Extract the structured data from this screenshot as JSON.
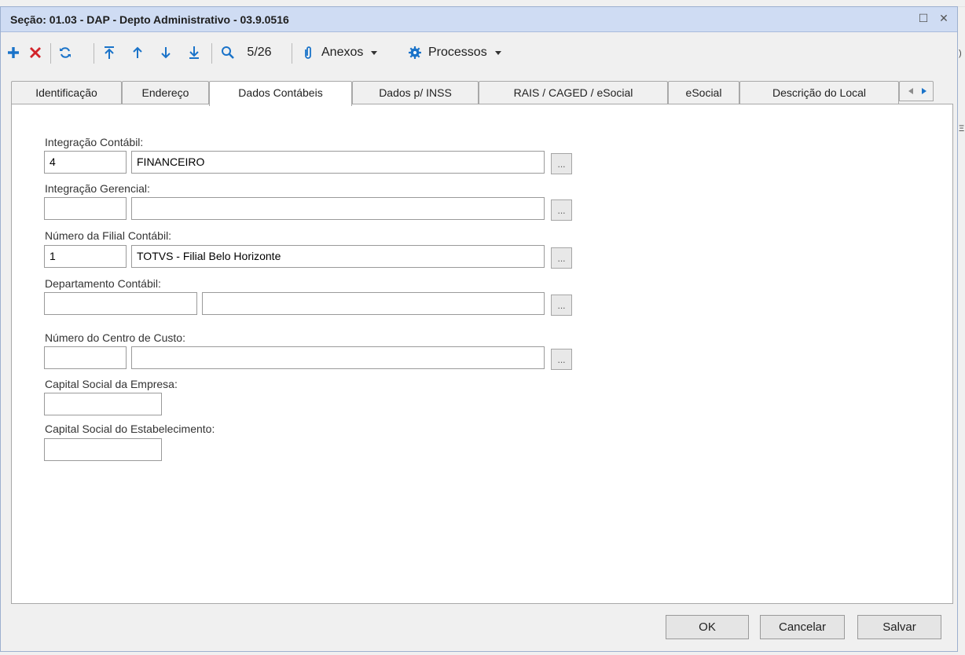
{
  "window": {
    "title": "Seção: 01.03 - DAP - Depto Administrativo - 03.9.0516",
    "maximize_glyph": "☐",
    "close_glyph": "✕"
  },
  "background_edge": {
    "fragment_1": ")",
    "fragment_2": "Ξ"
  },
  "toolbar": {
    "icons": [
      "add-icon",
      "delete-icon",
      "refresh-icon",
      "first-record-icon",
      "previous-record-icon",
      "next-record-icon",
      "last-record-icon",
      "search-icon",
      "paperclip-icon",
      "gear-icon",
      "chevron-down-icon"
    ],
    "record_counter": "5/26",
    "attachments_label": "Anexos",
    "processes_label": "Processos",
    "colors": {
      "add": "#1a73c9",
      "delete": "#d2232a",
      "nav": "#1a73c9"
    }
  },
  "tabs": [
    {
      "label": "Identificação",
      "active": false
    },
    {
      "label": "Endereço",
      "active": false
    },
    {
      "label": "Dados Contábeis",
      "active": true
    },
    {
      "label": "Dados p/ INSS",
      "active": false
    },
    {
      "label": "RAIS / CAGED / eSocial",
      "active": false
    },
    {
      "label": "eSocial",
      "active": false
    },
    {
      "label": "Descrição do Local",
      "active": false
    }
  ],
  "form": {
    "integracao_contabil": {
      "label": "Integração Contábil:",
      "code": "4",
      "description": "FINANCEIRO"
    },
    "integracao_gerencial": {
      "label": "Integração Gerencial:",
      "code": "",
      "description": ""
    },
    "filial_contabil": {
      "label": "Número da Filial Contábil:",
      "code": "1",
      "description": "TOTVS - Filial Belo Horizonte"
    },
    "departamento_contabil": {
      "label": "Departamento Contábil:",
      "code": "",
      "description": ""
    },
    "centro_custo": {
      "label": "Número do Centro de Custo:",
      "code": "",
      "description": ""
    },
    "capital_empresa": {
      "label": "Capital Social da Empresa:",
      "value": ""
    },
    "capital_estabelecimento": {
      "label": "Capital Social do Estabelecimento:",
      "value": ""
    },
    "lookup_label": "..."
  },
  "footer": {
    "ok_label": "OK",
    "cancel_label": "Cancelar",
    "save_label": "Salvar"
  }
}
